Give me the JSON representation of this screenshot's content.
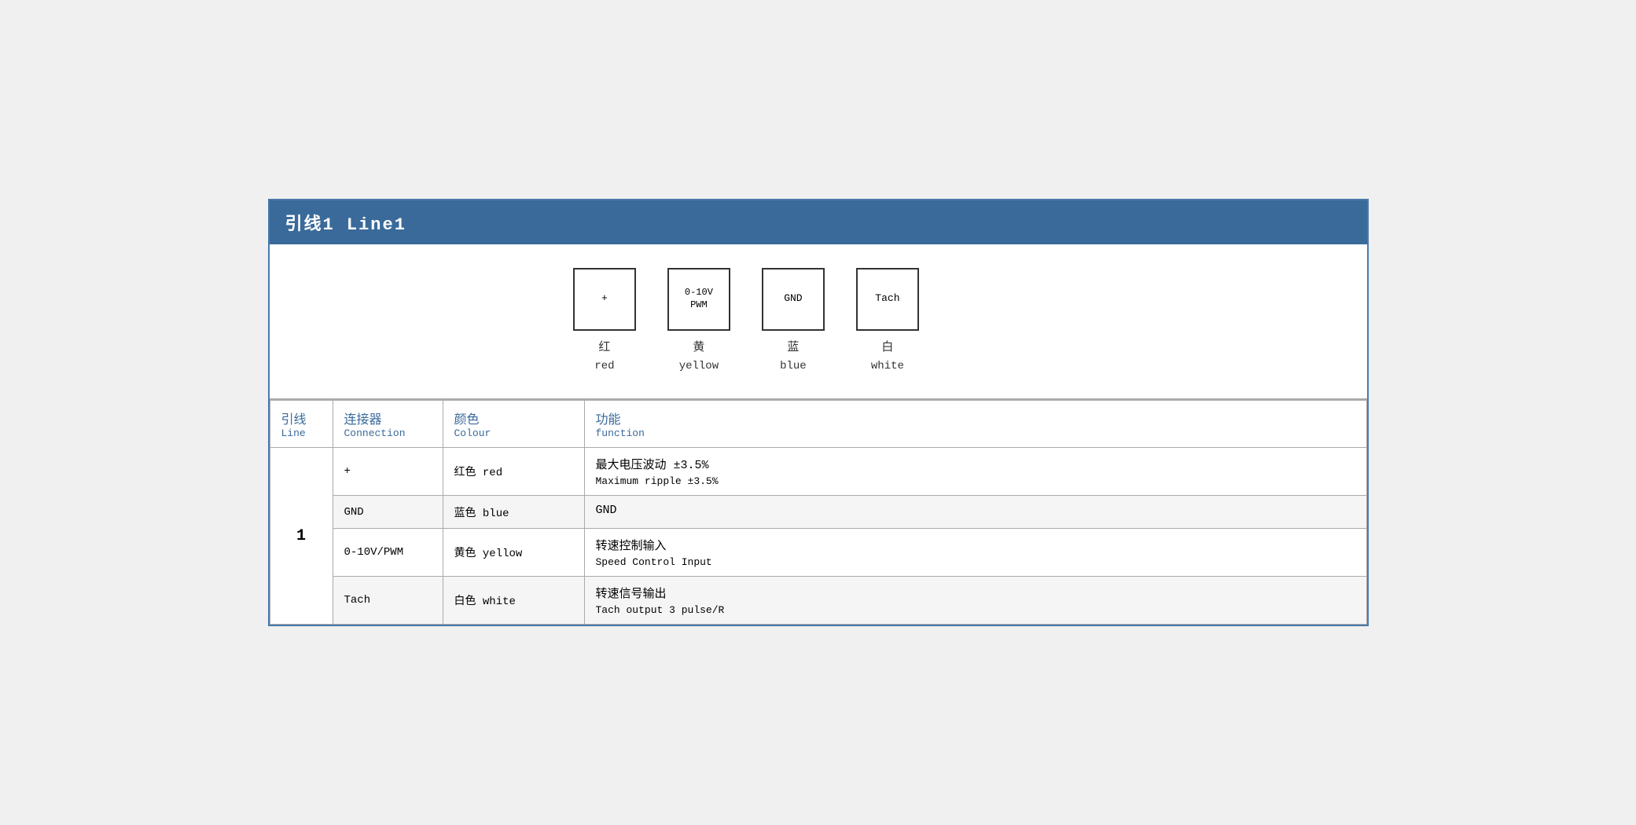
{
  "title": "引线1 Line1",
  "diagram": {
    "connectors": [
      {
        "symbol": "+",
        "chinese": "红",
        "english": "red"
      },
      {
        "symbol": "0-10V\nPWM",
        "chinese": "黄",
        "english": "yellow"
      },
      {
        "symbol": "GND",
        "chinese": "蓝",
        "english": "blue"
      },
      {
        "symbol": "Tach",
        "chinese": "白",
        "english": "white"
      }
    ]
  },
  "table": {
    "headers": {
      "line_chinese": "引线",
      "line_english": "Line",
      "connection_chinese": "连接器",
      "connection_english": "Connection",
      "colour_chinese": "颜色",
      "colour_english": "Colour",
      "function_chinese": "功能",
      "function_english": "function"
    },
    "rows": [
      {
        "line": "1",
        "connection": "+",
        "colour_chinese": "红色 red",
        "func_chinese": "最大电压波动 ±3.5%",
        "func_english": "Maximum ripple ±3.5%",
        "rowspan_start": true,
        "row_class": "row-plus"
      },
      {
        "connection": "GND",
        "colour_chinese": "蓝色 blue",
        "func_chinese": "GND",
        "func_english": "",
        "row_class": "row-gnd"
      },
      {
        "connection": "0-10V/PWM",
        "colour_chinese": "黄色 yellow",
        "func_chinese": "转速控制输入",
        "func_english": "Speed Control Input",
        "row_class": "row-pwm"
      },
      {
        "connection": "Tach",
        "colour_chinese": "白色 white",
        "func_chinese": "转速信号输出",
        "func_english": "Tach output 3 pulse/R",
        "row_class": "row-tach"
      }
    ]
  }
}
